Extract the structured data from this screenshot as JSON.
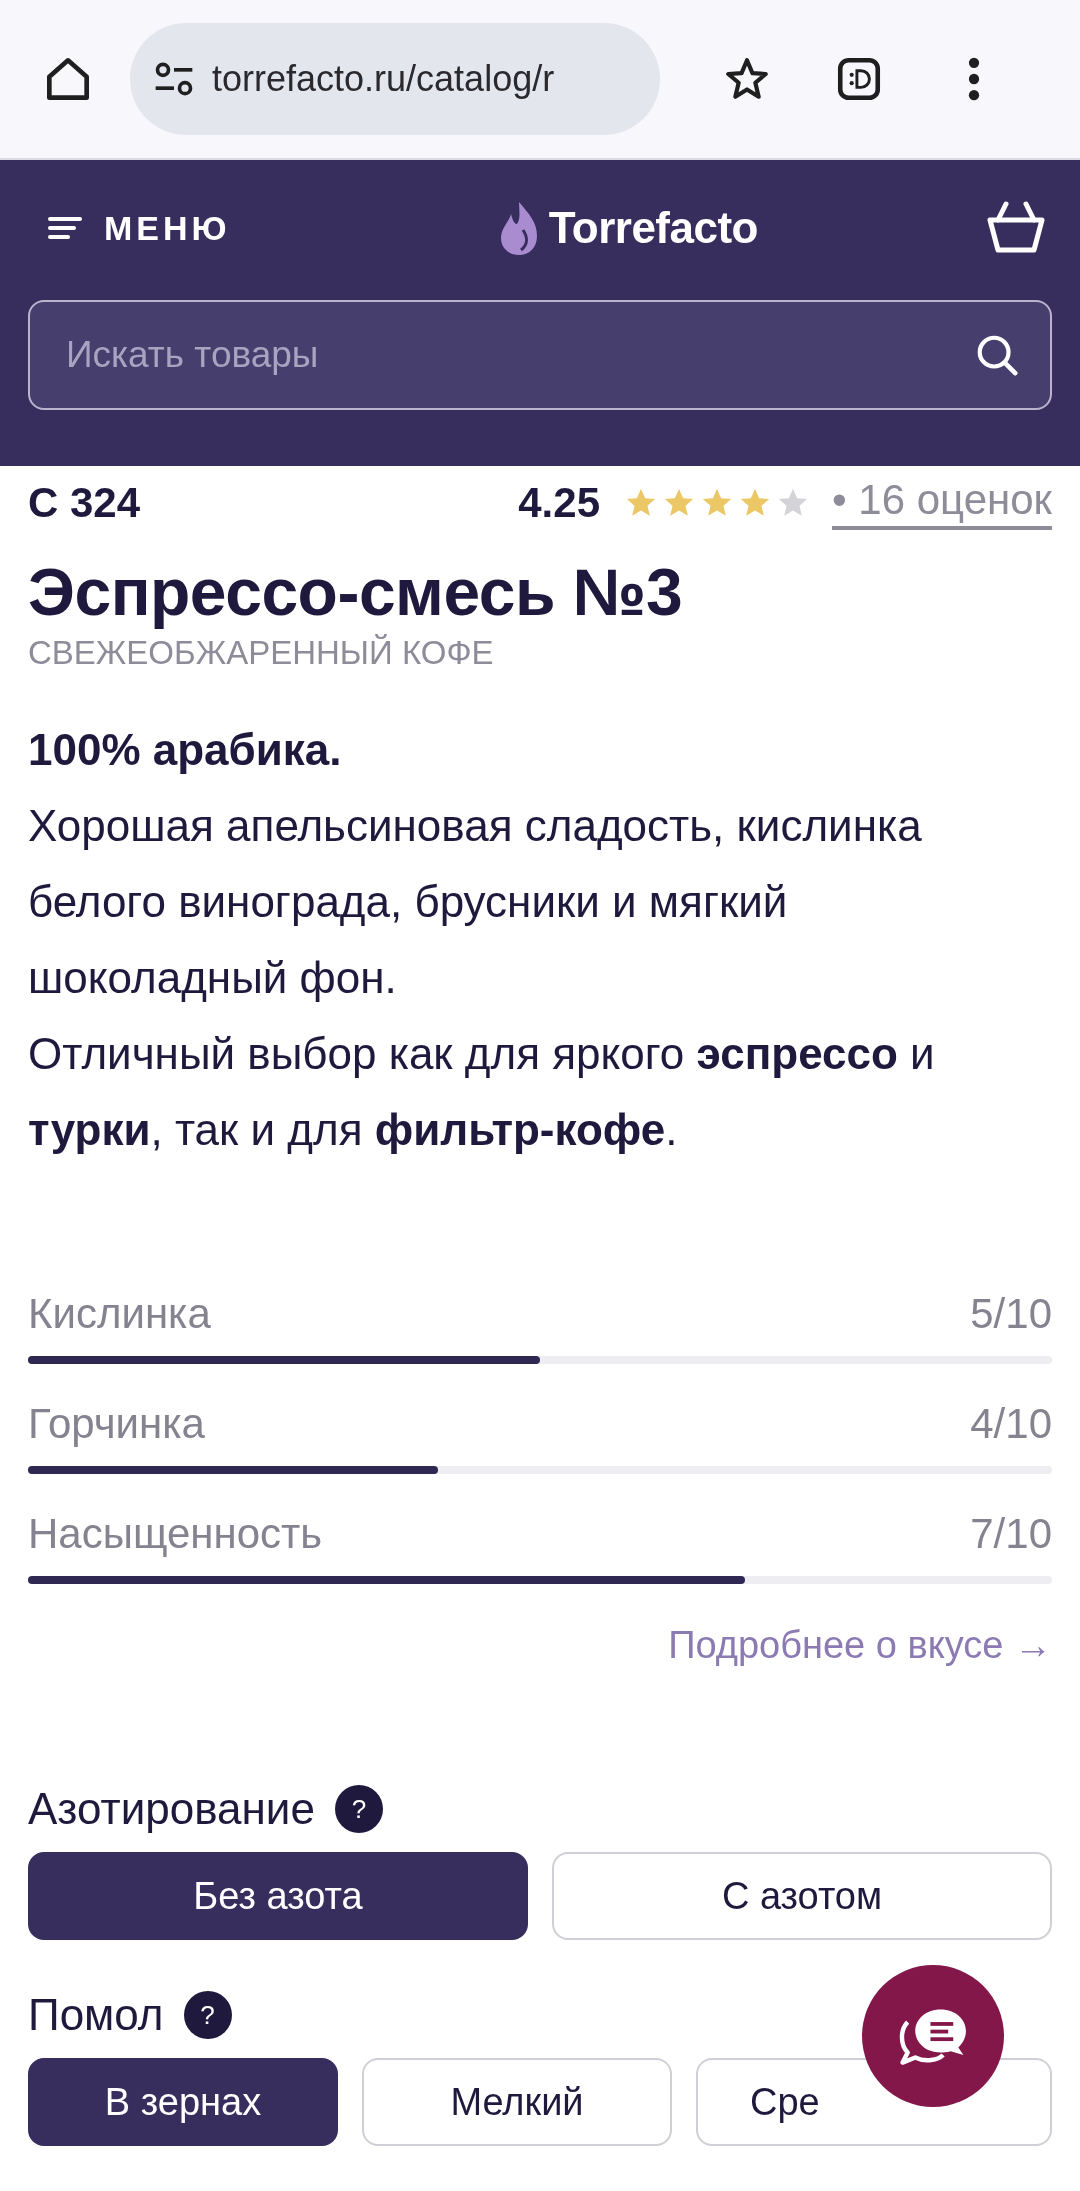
{
  "browser": {
    "url": "torrefacto.ru/catalog/r"
  },
  "header": {
    "menu_label": "МЕНЮ",
    "logo_text": "Torrefacto"
  },
  "search": {
    "placeholder": "Искать товары"
  },
  "product": {
    "code": "C 324",
    "rating": "4.25",
    "stars": 4,
    "reviews_link": "• 16 оценок",
    "title": "Эспрессо-смесь №3",
    "category": "СВЕЖЕОБЖАРЕННЫЙ КОФЕ"
  },
  "description": {
    "lead": "100% арабика.",
    "paragraphs": [
      "Хорошая апельсиновая сладость, кислинка белого винограда, брусники и мягкий шоколадный фон.",
      "Отличный выбор как для яркого **эспрессо** и **турки**, так и для **фильтр-кофе**."
    ]
  },
  "taste": [
    {
      "name": "Кислинка",
      "reading": "5/10",
      "level": 0.5
    },
    {
      "name": "Горчинка",
      "reading": "4/10",
      "level": 0.4
    },
    {
      "name": "Насыщенность",
      "reading": "7/10",
      "level": 0.7
    }
  ],
  "taste_link": "Подробнее о вкусе →",
  "options": [
    {
      "title": "Азотирование",
      "help": "?",
      "choices": [
        {
          "label": "Без азота",
          "selected": true
        },
        {
          "label": "С азотом",
          "selected": false
        }
      ]
    },
    {
      "title": "Помол",
      "help": "?",
      "choices": [
        {
          "label": "В зернах",
          "selected": true
        },
        {
          "label": "Мелкий",
          "selected": false
        },
        {
          "label": "Сре",
          "selected": false
        }
      ]
    }
  ]
}
